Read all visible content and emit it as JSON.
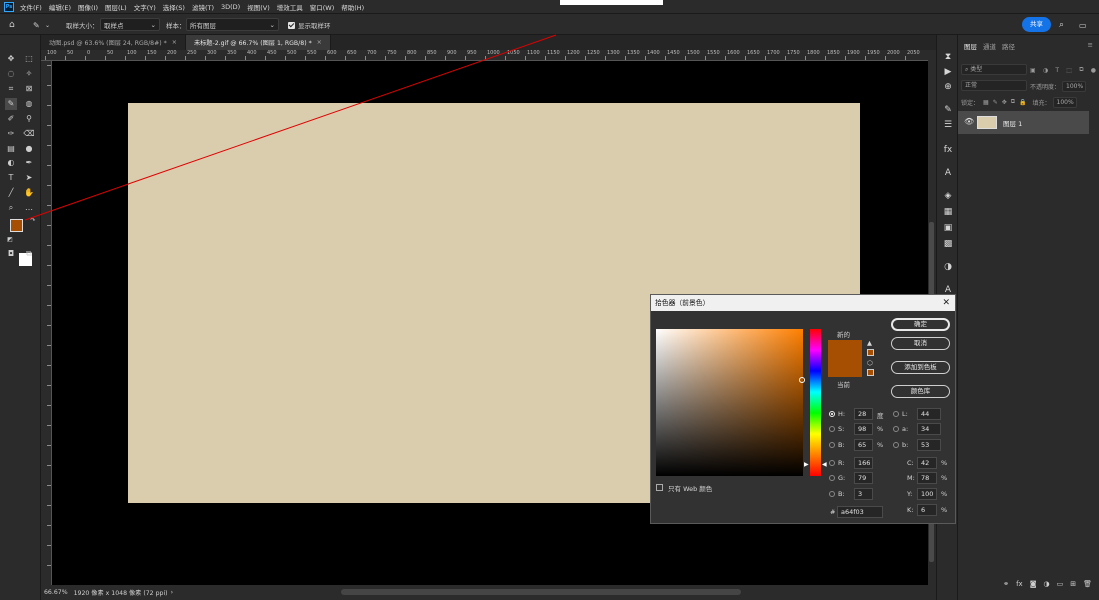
{
  "menubar": {
    "logo": "Ps",
    "items": [
      "文件(F)",
      "编辑(E)",
      "图像(I)",
      "图层(L)",
      "文字(Y)",
      "选择(S)",
      "滤镜(T)",
      "3D(D)",
      "视图(V)",
      "增效工具",
      "窗口(W)",
      "帮助(H)"
    ]
  },
  "options": {
    "sample_size_label": "取样大小：",
    "sample_size_value": "取样点",
    "sample_label": "样本：",
    "sample_value": "所有图层",
    "show_ring_label": "显示取样环",
    "share": "共享"
  },
  "tabs": [
    {
      "label": "动图.psd @ 63.6% (图层 24, RGB/8#) *"
    },
    {
      "label": "未标题-2.gif @ 66.7% (图层 1, RGB/8) *"
    }
  ],
  "ruler": {
    "top_labels": [
      "100",
      "50",
      "0",
      "50",
      "100",
      "150",
      "200",
      "250",
      "300",
      "350",
      "400",
      "450",
      "500",
      "550",
      "600",
      "650",
      "700",
      "750",
      "800",
      "850",
      "900",
      "950",
      "1000",
      "1050",
      "1100",
      "1150",
      "1200",
      "1250",
      "1300",
      "1350",
      "1400",
      "1450",
      "1500",
      "1550",
      "1600",
      "1650",
      "1700",
      "1750",
      "1800",
      "1850",
      "1900",
      "1950",
      "2000",
      "2050"
    ]
  },
  "status": {
    "zoom": "66.67%",
    "doc_info": "1920 像素 x 1048 像素 (72 ppi)"
  },
  "layers_panel": {
    "tabs": [
      "图层",
      "通道",
      "路径"
    ],
    "filter_type": "类型",
    "blend_mode": "正常",
    "opacity_label": "不透明度：",
    "opacity_value": "100%",
    "lock_label": "锁定：",
    "fill_label": "填充：",
    "fill_value": "100%",
    "layer_name": "图层 1"
  },
  "picker": {
    "title": "拾色器（前景色）",
    "new_label": "新的",
    "current_label": "当前",
    "ok": "确定",
    "cancel": "取消",
    "add_swatch": "添加到色板",
    "color_libraries": "颜色库",
    "web_only": "只有 Web 颜色",
    "H": "28",
    "S": "98",
    "B": "65",
    "R": "166",
    "G": "79",
    "Bv": "3",
    "L": "44",
    "a": "34",
    "b": "53",
    "C": "42",
    "M": "78",
    "Y": "100",
    "K": "6",
    "hex": "a64f03",
    "deg": "度",
    "pct": "%",
    "labels": {
      "H": "H:",
      "S": "S:",
      "B": "B:",
      "R": "R:",
      "G": "G:",
      "Bl": "B:",
      "L": "L:",
      "a": "a:",
      "b": "b:",
      "C": "C:",
      "M": "M:",
      "Y": "Y:",
      "K": "K:",
      "hash": "#"
    }
  },
  "colors": {
    "foreground": "#a64f03",
    "document": "#d9cdae",
    "accent": "#1473e6"
  }
}
